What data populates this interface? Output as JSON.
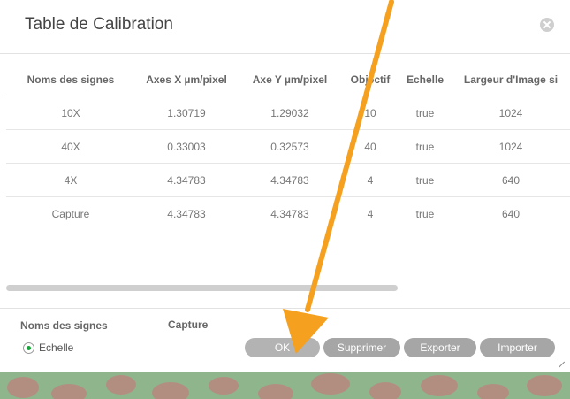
{
  "dialog": {
    "title": "Table de Calibration",
    "close_icon": "close-icon"
  },
  "table": {
    "columns": [
      "Noms des signes",
      "Axes X µm/pixel",
      "Axe Y µm/pixel",
      "Objectif",
      "Echelle",
      "Largeur d'Image si"
    ],
    "rows": [
      [
        "10X",
        "1.30719",
        "1.29032",
        "10",
        "true",
        "1024"
      ],
      [
        "40X",
        "0.33003",
        "0.32573",
        "40",
        "true",
        "1024"
      ],
      [
        "4X",
        "4.34783",
        "4.34783",
        "4",
        "true",
        "640"
      ],
      [
        "Capture",
        "4.34783",
        "4.34783",
        "4",
        "true",
        "640"
      ]
    ]
  },
  "footer": {
    "names_label": "Noms des signes",
    "names_value": "Capture",
    "scale_radio_label": "Echelle",
    "buttons": {
      "ok": "OK",
      "delete": "Supprimer",
      "export": "Exporter",
      "import": "Importer"
    }
  },
  "colors": {
    "annotation_arrow": "#f5a11f",
    "radio_selected": "#1aa33a",
    "button_bg": "#a6a6a6"
  }
}
